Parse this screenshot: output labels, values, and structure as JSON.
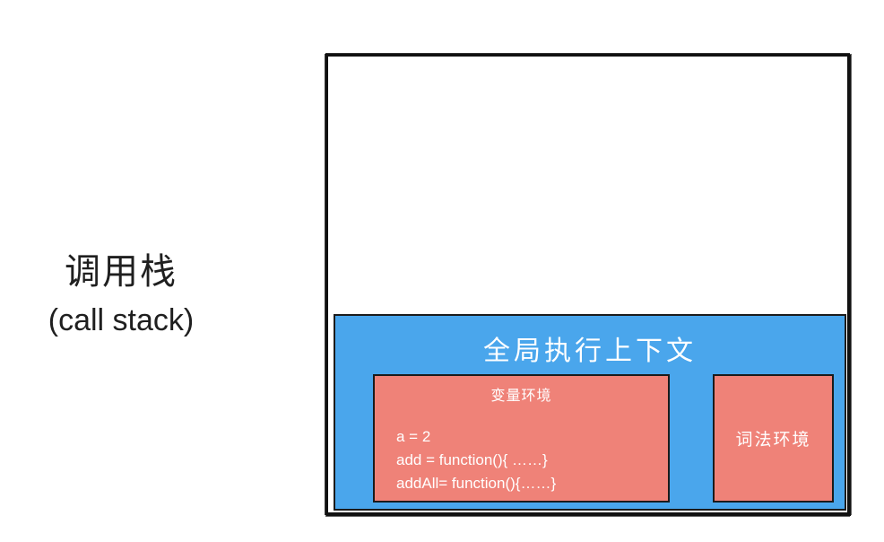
{
  "caption": {
    "title_cn": "调用栈",
    "title_en": "(call stack)"
  },
  "global_context": {
    "title": "全局执行上下文"
  },
  "variable_environment": {
    "title": "变量环境",
    "lines": [
      "a = 2",
      "add = function(){ ……}",
      "addAll= function(){……}"
    ]
  },
  "lexical_environment": {
    "title": "词法环境"
  },
  "colors": {
    "global_context": "#4aa6ec",
    "environment": "#ef8278",
    "border": "#111111"
  }
}
